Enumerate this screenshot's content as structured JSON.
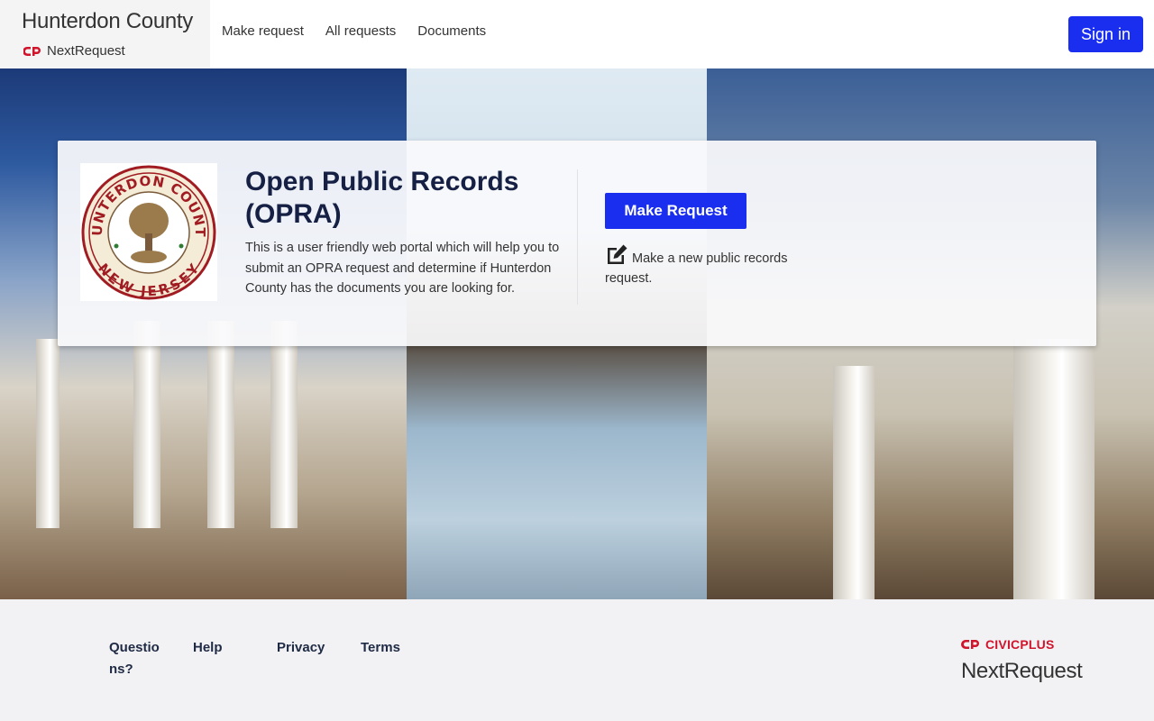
{
  "header": {
    "brand_title": "Hunterdon County",
    "brand_sub": "NextRequest",
    "nav": [
      "Make request",
      "All requests",
      "Documents"
    ],
    "signin_label": "Sign in"
  },
  "hero": {
    "seal_top_text": "HUNTERDON COUNTY",
    "seal_bottom_text": "NEW JERSEY",
    "title": "Open Public Records (OPRA)",
    "description": "This is a user friendly web portal which will help you to submit an OPRA request and determine if Hunterdon County has the documents you are looking for.",
    "make_request_label": "Make Request",
    "make_request_note": "Make a new public records request."
  },
  "footer": {
    "links": [
      "Questions?",
      "Help",
      "Privacy",
      "Terms"
    ],
    "civicplus": "CIVICPLUS",
    "nextrequest": "NextRequest"
  },
  "colors": {
    "accent": "#1a2ef0",
    "brand_red": "#d0142c",
    "title_navy": "#152044"
  },
  "icons": [
    "civicplus-logo-icon",
    "edit-icon",
    "county-seal"
  ]
}
